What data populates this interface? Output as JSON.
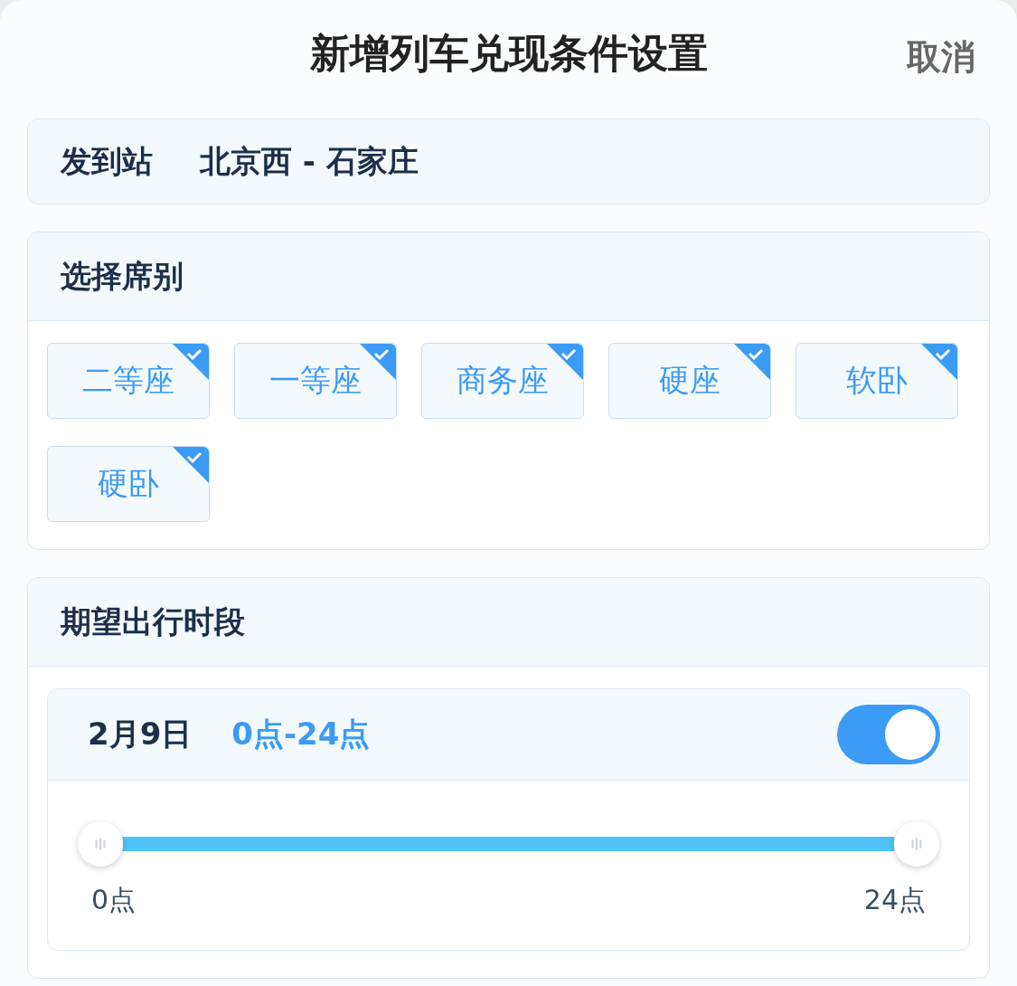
{
  "header": {
    "title": "新增列车兑现条件设置",
    "cancel": "取消"
  },
  "route": {
    "label": "发到站",
    "value": "北京西 - 石家庄"
  },
  "seats": {
    "title": "选择席别",
    "options": [
      {
        "label": "二等座",
        "checked": true
      },
      {
        "label": "一等座",
        "checked": true
      },
      {
        "label": "商务座",
        "checked": true
      },
      {
        "label": "硬座",
        "checked": true
      },
      {
        "label": "软卧",
        "checked": true
      },
      {
        "label": "硬卧",
        "checked": true
      }
    ]
  },
  "time": {
    "title": "期望出行时段",
    "days": [
      {
        "date": "2月9日",
        "range": "0点-24点",
        "on": true,
        "slider": {
          "thumbs": [
            {
              "level": 0
            },
            {
              "level": 1
            }
          ],
          "min_label": "0点",
          "max_label": "24点"
        }
      }
    ]
  }
}
